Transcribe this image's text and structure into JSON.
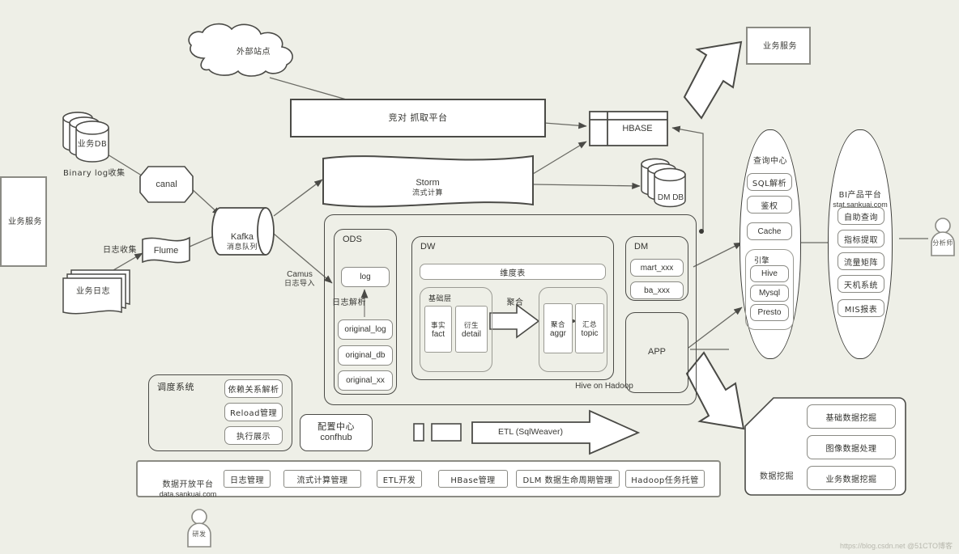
{
  "meta": {
    "watermark": "https://blog.csdn.net @51CTO博客"
  },
  "sources": {
    "biz_service_left": "业务服务",
    "biz_db": "业务DB",
    "biz_log": "业务日志",
    "binary_log_label": "Binary log收集",
    "log_collect_label": "日志收集",
    "canal": "canal",
    "flume": "Flume",
    "external_site": "外部站点",
    "crawler_platform": "竞对 抓取平台"
  },
  "bus": {
    "kafka_title": "Kafka",
    "kafka_sub": "消息队列",
    "camus_label": "Camus",
    "camus_sub": "日志导入"
  },
  "stream": {
    "storm_title": "Storm",
    "storm_sub": "流式计算"
  },
  "stores": {
    "hbase": "HBASE",
    "dm_db": "DM DB"
  },
  "hadoop": {
    "footer": "Hive on Hadoop",
    "ods": {
      "title": "ODS",
      "log": "log",
      "parse_label": "日志解析",
      "items": [
        "original_log",
        "original_db",
        "original_xx"
      ]
    },
    "dw": {
      "title": "DW",
      "dim_table": "维度表",
      "base_layer": "基础层",
      "fact_cn": "事实",
      "fact_en": "fact",
      "detail_cn": "衍生",
      "detail_en": "detail",
      "aggregate_label": "聚合",
      "aggr_cn": "聚合",
      "aggr_en": "aggr",
      "topic_cn": "汇总",
      "topic_en": "topic"
    },
    "dm": {
      "title": "DM",
      "items": [
        "mart_xxx",
        "ba_xxx"
      ]
    },
    "app": {
      "title": "APP"
    }
  },
  "query_center": {
    "title": "查询中心",
    "items": [
      "SQL解析",
      "鉴权",
      "Cache"
    ],
    "engine_title": "引擎",
    "engines": [
      "Hive",
      "Mysql",
      "Presto"
    ]
  },
  "bi_platform": {
    "title": "BI产品平台",
    "domain": "stat.sankuai.com",
    "items": [
      "自助查询",
      "指标提取",
      "流量矩阵",
      "天机系统",
      "MIS报表"
    ]
  },
  "biz_service_top": {
    "label": "业务服务"
  },
  "scheduler": {
    "title": "调度系统",
    "items": [
      "依赖关系解析",
      "Reload管理",
      "执行展示"
    ]
  },
  "config_center": {
    "title": "配置中心",
    "sub": "confhub"
  },
  "etl": {
    "label": "ETL (SqlWeaver)"
  },
  "data_mining": {
    "title": "数据挖掘",
    "items": [
      "基础数据挖掘",
      "图像数据处理",
      "业务数据挖掘"
    ]
  },
  "open_platform": {
    "title": "数据开放平台",
    "domain": "data.sankuai.com",
    "items": [
      "日志管理",
      "流式计算管理",
      "ETL开发",
      "HBase管理",
      "DLM 数据生命周期管理",
      "Hadoop任务托管"
    ]
  },
  "actors": {
    "analyst": "分析师",
    "developer": "研发"
  },
  "colors": {
    "background": "#eeefe7",
    "stroke": "#4a4a46",
    "fill": "#ffffff",
    "soft_stroke": "#8a8a84"
  }
}
